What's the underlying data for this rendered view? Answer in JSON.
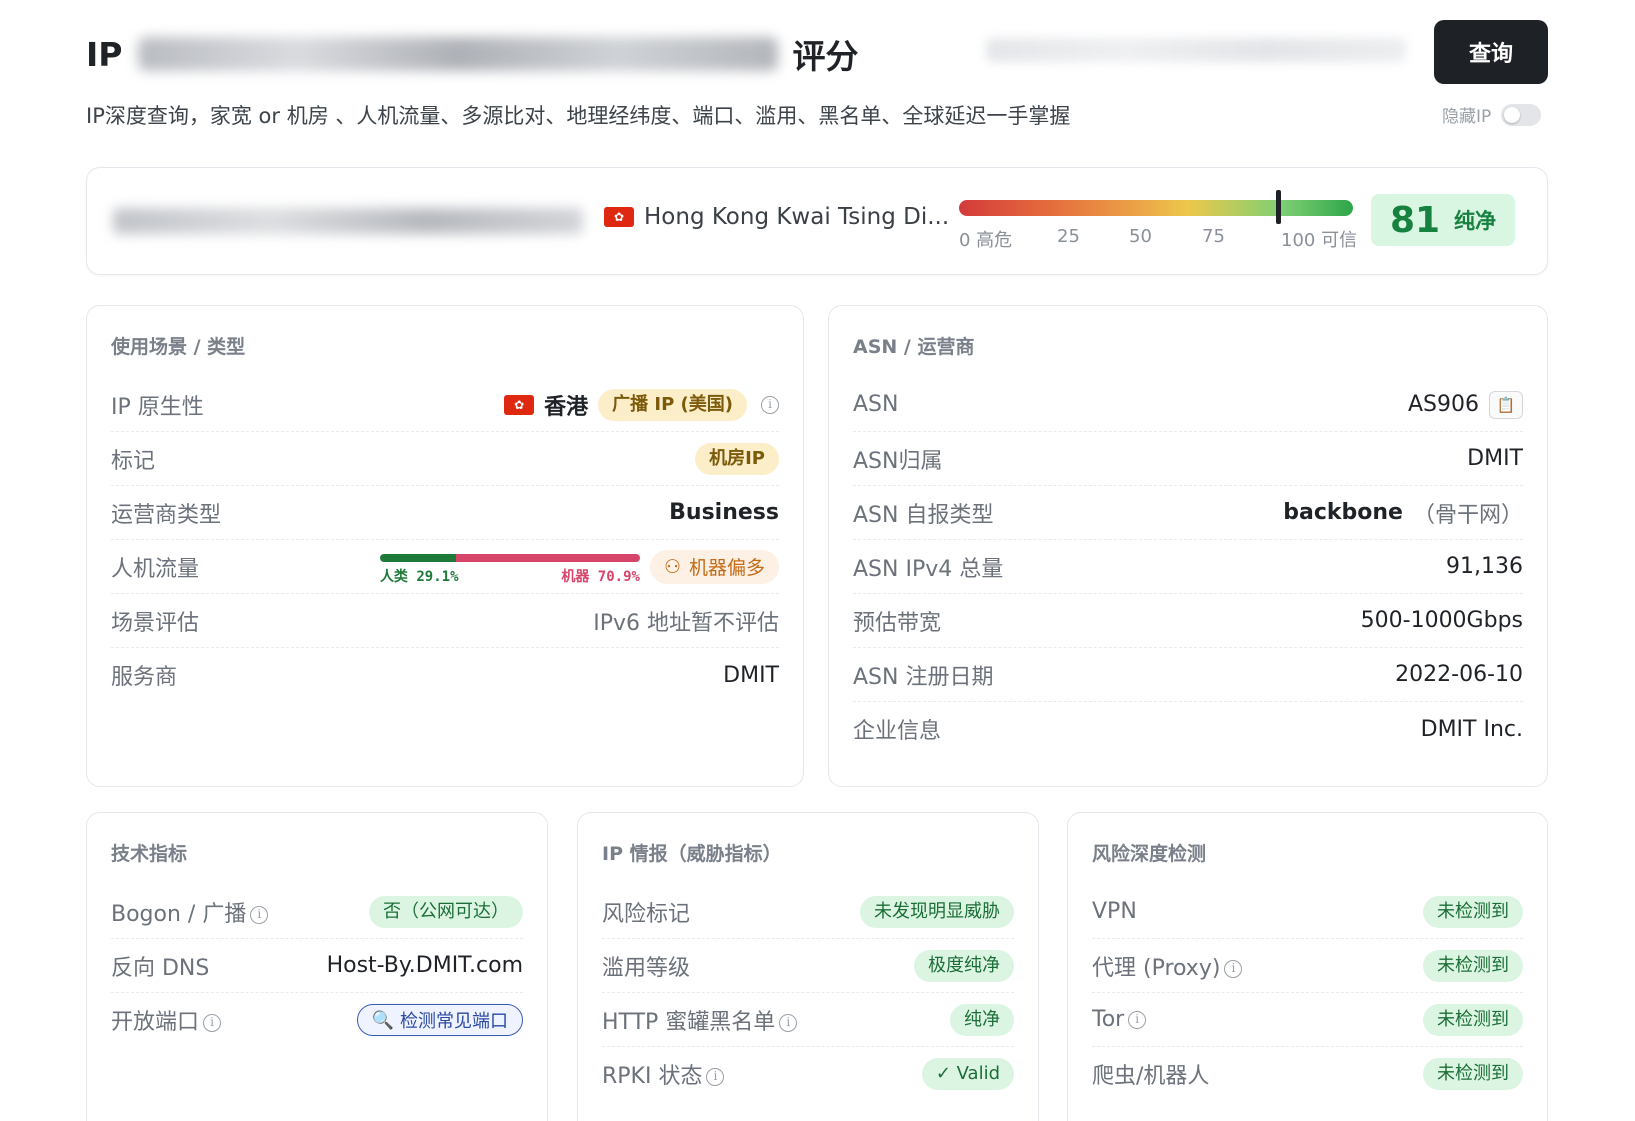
{
  "header": {
    "title_prefix": "IP",
    "title_suffix": "评分",
    "query_button": "查询",
    "subtitle": "IP深度查询，家宽 or 机房 、人机流量、多源比对、地理经纬度、端口、滥用、黑名单、全球延迟一手掌握",
    "hide_ip_label": "隐藏IP"
  },
  "summary": {
    "location": "Hong Kong Kwai Tsing Di...",
    "flag_icon": "hong-kong-flag-icon",
    "meter": {
      "value": 81,
      "ticks": [
        "0 高危",
        "25",
        "50",
        "75",
        "100 可信"
      ]
    },
    "score": "81",
    "score_label": "纯净"
  },
  "usage": {
    "title": "使用场景 / 类型",
    "rows": {
      "native": {
        "label": "IP 原生性",
        "region": "香港",
        "badge": "广播 IP (美国)"
      },
      "tag": {
        "label": "标记",
        "badge": "机房IP"
      },
      "carrier": {
        "label": "运营商类型",
        "value": "Business"
      },
      "traffic": {
        "label": "人机流量",
        "human_label": "人类 29.1%",
        "bot_label": "机器 70.9%",
        "human_pct": 29.1,
        "bot_pct": 70.9,
        "badge": "机器偏多"
      },
      "scenario": {
        "label": "场景评估",
        "value": "IPv6 地址暂不评估"
      },
      "provider": {
        "label": "服务商",
        "value": "DMIT"
      }
    }
  },
  "asn": {
    "title": "ASN / 运营商",
    "rows": {
      "asn": {
        "label": "ASN",
        "value": "AS906"
      },
      "owner": {
        "label": "ASN归属",
        "value": "DMIT"
      },
      "type": {
        "label": "ASN 自报类型",
        "value": "backbone",
        "note": "（骨干网）"
      },
      "ipv4": {
        "label": "ASN IPv4 总量",
        "value": "91,136"
      },
      "bandwidth": {
        "label": "预估带宽",
        "value": "500-1000Gbps"
      },
      "date": {
        "label": "ASN 注册日期",
        "value": "2022-06-10"
      },
      "org": {
        "label": "企业信息",
        "value": "DMIT Inc."
      }
    }
  },
  "tech": {
    "title": "技术指标",
    "rows": {
      "bogon": {
        "label": "Bogon / 广播",
        "value": "否（公网可达）"
      },
      "rdns": {
        "label": "反向 DNS",
        "value": "Host-By.DMIT.com"
      },
      "ports": {
        "label": "开放端口",
        "button": "检测常见端口"
      }
    }
  },
  "intel": {
    "title": "IP 情报（威胁指标）",
    "rows": {
      "risk": {
        "label": "风险标记",
        "value": "未发现明显威胁"
      },
      "abuse": {
        "label": "滥用等级",
        "value": "极度纯净"
      },
      "honeypot": {
        "label": "HTTP 蜜罐黑名单",
        "value": "纯净"
      },
      "rpki": {
        "label": "RPKI 状态",
        "value": "✓ Valid"
      }
    }
  },
  "risk": {
    "title": "风险深度检测",
    "rows": {
      "vpn": {
        "label": "VPN",
        "value": "未检测到"
      },
      "proxy": {
        "label": "代理 (Proxy)",
        "value": "未检测到"
      },
      "tor": {
        "label": "Tor",
        "value": "未检测到"
      },
      "crawler": {
        "label": "爬虫/机器人",
        "value": "未检测到"
      }
    }
  }
}
